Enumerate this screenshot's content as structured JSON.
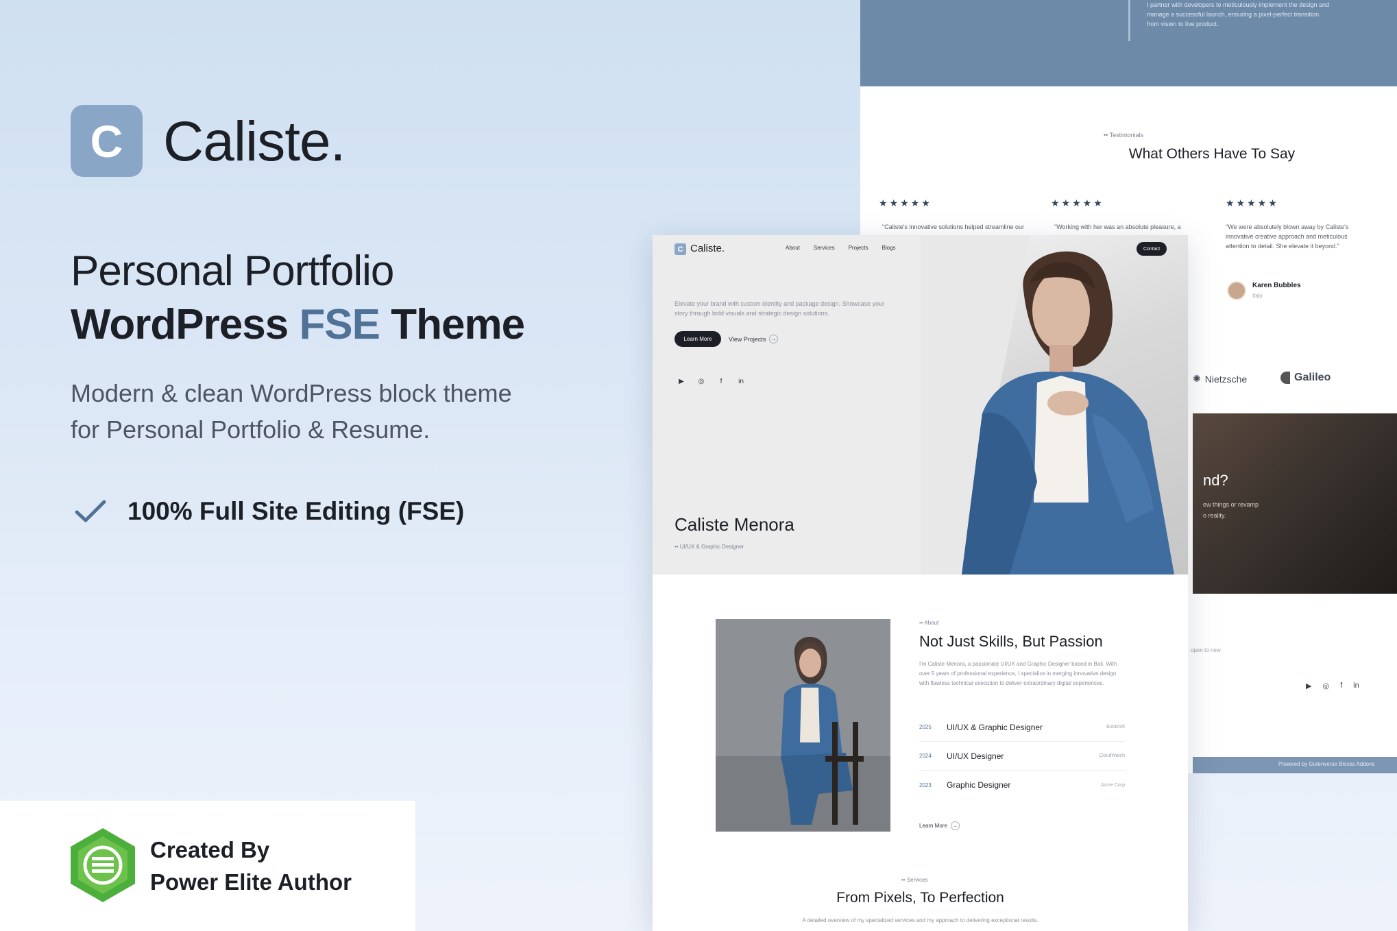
{
  "brand": {
    "logo_letter": "C",
    "name": "Caliste.",
    "accent_color": "#4f7296",
    "logo_color": "#8aa6c7"
  },
  "promo": {
    "headline_line1": "Personal Portfolio",
    "headline_line2_part1": "WordPress",
    "headline_line2_highlight": "FSE",
    "headline_line2_part2": "Theme",
    "subtitle_line1": "Modern & clean WordPress block theme",
    "subtitle_line2": "for Personal Portfolio & Resume.",
    "feature": "100% Full Site Editing (FSE)",
    "created_by_line1": "Created By",
    "created_by_line2": "Power Elite Author"
  },
  "back_page": {
    "hero_text": "I partner with developers to meticulously implement the design and manage a successful launch, ensuring a pixel-perfect transition from vision to live product.",
    "testimonials_tag": "•• Testimonials",
    "testimonials_title": "What Others Have To Say",
    "stars": "★★★★★",
    "quotes": [
      "\"Caliste's innovative solutions helped streamline our",
      "\"Working with her was an absolute pleasure, a",
      "\"We were absolutely blown away by Caliste's innovative creative approach and meticulous attention to detail. She elevate it beyond.\""
    ],
    "reviewer_name": "Karen Bubbles",
    "reviewer_location": "Italy",
    "brands": [
      "Nietzsche",
      "Galileo"
    ],
    "cta_question": "nd?",
    "cta_text_line1": "ew things or revamp",
    "cta_text_line2": "o reality.",
    "open_text": "open to new",
    "social": [
      "▶",
      "◎",
      "f",
      "in"
    ],
    "footer_text": "Powered by Gutenverse Blocks Addons"
  },
  "front_page": {
    "logo_letter": "C",
    "logo_name": "Caliste.",
    "nav": [
      "About",
      "Services",
      "Projects",
      "Blogs"
    ],
    "contact_label": "Contact",
    "intro": "Elevate your brand with custom identity and package design. Showcase your story through bold visuals and strategic design solutions.",
    "learn_more": "Learn More",
    "view_projects": "View Projects",
    "social": [
      "▶",
      "◎",
      "f",
      "in"
    ],
    "name": "Caliste Menora",
    "role": "•• UI/UX & Graphic Designer",
    "about_tag": "•• About",
    "about_title": "Not Just Skills, But Passion",
    "about_text": "I'm Caliste Menora, a passionate UI/UX and Graphic Designer based in Bali. With over 5 years of professional experience, I specialize in merging innovative design with flawless technical execution to deliver extraordinary digital experiences.",
    "jobs": [
      {
        "year": "2025",
        "title": "UI/UX & Graphic Designer",
        "company": "Boldshift"
      },
      {
        "year": "2024",
        "title": "UI/UX Designer",
        "company": "CloudWatch"
      },
      {
        "year": "2023",
        "title": "Graphic Designer",
        "company": "Acme Corp"
      }
    ],
    "about_learn_more": "Learn More",
    "services_tag": "•• Services",
    "services_title": "From Pixels, To Perfection",
    "services_text": "A detailed overview of my specialized services and my approach to delivering exceptional results."
  }
}
